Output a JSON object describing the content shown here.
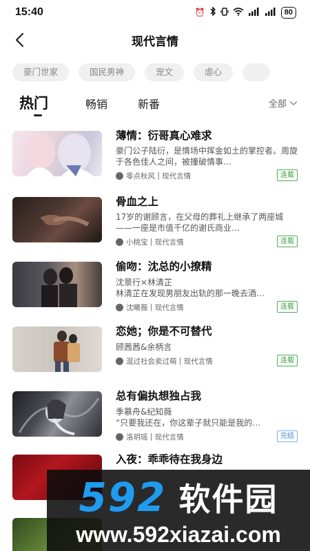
{
  "status": {
    "time": "15:40",
    "battery": "80"
  },
  "header": {
    "title": "现代言情"
  },
  "categories": [
    "豪门世家",
    "国民男神",
    "宠文",
    "虐心"
  ],
  "tabs": {
    "items": [
      "热门",
      "畅销",
      "新番"
    ],
    "active": 0
  },
  "filter": {
    "label": "全部"
  },
  "books": [
    {
      "title": "薄情：衍哥真心难求",
      "desc": "豪门公子陆衍，是情场中挥金如土的掌控者。周旋于各色佳人之间，被撞破情事…",
      "author": "零点秋风",
      "genre": "现代言情",
      "status": "连载"
    },
    {
      "title": "骨血之上",
      "desc": "17岁的谢顾言，在父母的葬礼上继承了两座城——一座是市值千亿的谢氏商业…",
      "author": "小桃宝",
      "genre": "现代言情",
      "status": "连载"
    },
    {
      "title": "偷吻：沈总的小撩精",
      "desc_line1": "沈景行×林清芷",
      "desc_line2": "林清芷在发现男朋友出轨的那一晚去酒…",
      "author": "沈曦薇",
      "genre": "现代言情",
      "status": "连载"
    },
    {
      "title": "恋她；你是不可替代",
      "desc_line1": "顾茜茜&余柄言",
      "desc_line2": "",
      "author": "混过社会卖过萌",
      "genre": "现代言情",
      "status": "连载"
    },
    {
      "title": "总有偏执想独占我",
      "desc_line1": "季慕舟&纪知薇",
      "desc_line2": "“只要我还在，你这辈子就只能是我的…",
      "author": "洛玥瑶",
      "genre": "现代言情",
      "status": "完结"
    },
    {
      "title": "入夜：乖乖待在我身边"
    }
  ],
  "watermark": {
    "number": "592",
    "name": "软件园",
    "url": "www.592xiazai.com"
  }
}
